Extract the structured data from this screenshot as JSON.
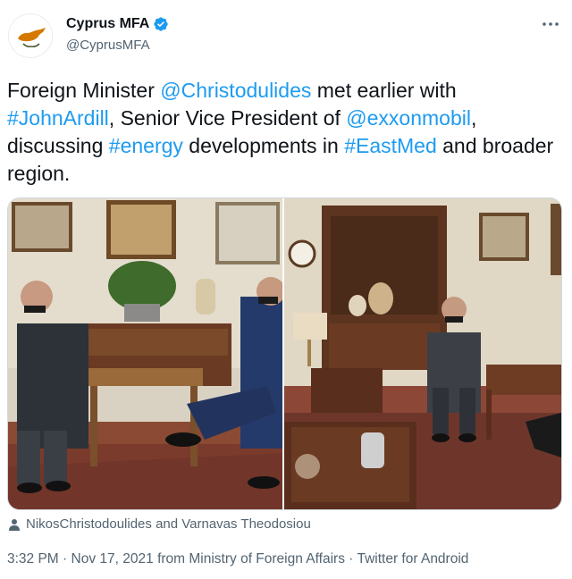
{
  "author": {
    "display_name": "Cyprus MFA",
    "handle": "@CyprusMFA",
    "verified_icon": "verified-badge-icon",
    "avatar_icon": "cyprus-flag-avatar"
  },
  "tweet": {
    "segments": [
      {
        "text": "Foreign Minister ",
        "type": "text"
      },
      {
        "text": "@Christodulides",
        "type": "mention"
      },
      {
        "text": " met earlier with ",
        "type": "text"
      },
      {
        "text": "#JohnArdill",
        "type": "hashtag"
      },
      {
        "text": ", Senior Vice President of ",
        "type": "text"
      },
      {
        "text": "@exxonmobil",
        "type": "mention"
      },
      {
        "text": ", discussing ",
        "type": "text"
      },
      {
        "text": "#energy",
        "type": "hashtag"
      },
      {
        "text": " developments in ",
        "type": "text"
      },
      {
        "text": "#EastMed",
        "type": "hashtag"
      },
      {
        "text": " and broader region.",
        "type": "text"
      }
    ],
    "tagged_people": "NikosChristodoulides and Varnavas Theodosiou",
    "time": "3:32 PM",
    "date": "Nov 17, 2021",
    "source_prefix": "from",
    "source": "Ministry of Foreign Affairs",
    "client": "Twitter for Android",
    "separator": "·"
  },
  "colors": {
    "link": "#1d9bf0",
    "text": "#0f1419",
    "secondary": "#536471"
  }
}
